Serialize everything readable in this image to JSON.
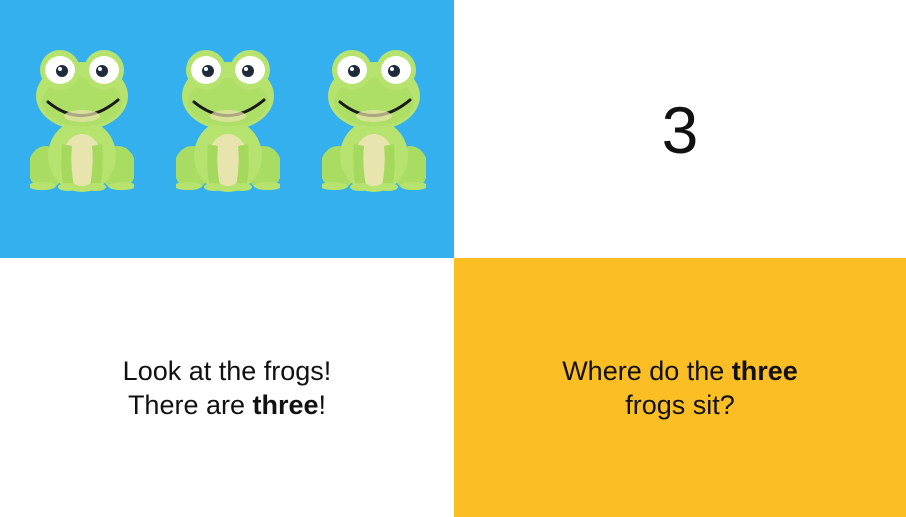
{
  "colors": {
    "sky": "#35b0ef",
    "gold": "#fbbe24",
    "frog_light": "#b5e36e",
    "frog_dark": "#8fcf55",
    "belly": "#e8e4ae"
  },
  "icons": [
    "frog-icon",
    "frog-icon",
    "frog-icon"
  ],
  "number_card": {
    "value": "3"
  },
  "caption_left": {
    "line1": "Look at the frogs!",
    "line2_prefix": "There are ",
    "line2_bold": "three",
    "line2_suffix": "!"
  },
  "caption_right": {
    "line1_prefix": "Where do the ",
    "line1_bold": "three",
    "line2": "frogs sit?"
  }
}
